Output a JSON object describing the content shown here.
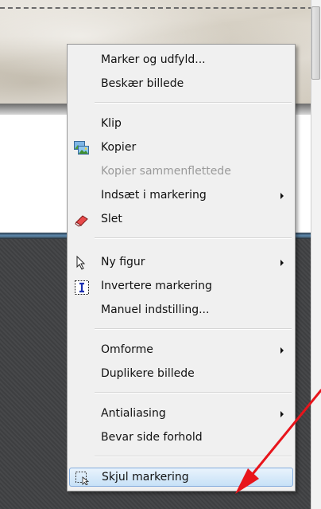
{
  "menu": {
    "items": [
      {
        "label": "Marker og udfyld...",
        "icon": null,
        "submenu": false,
        "disabled": false
      },
      {
        "label": "Beskær billede",
        "icon": null,
        "submenu": false,
        "disabled": false
      },
      {
        "label": "Klip",
        "icon": null,
        "submenu": false,
        "disabled": false
      },
      {
        "label": "Kopier",
        "icon": "copy-image-icon",
        "submenu": false,
        "disabled": false
      },
      {
        "label": "Kopier sammenflettede",
        "icon": null,
        "submenu": false,
        "disabled": true
      },
      {
        "label": "Indsæt i markering",
        "icon": null,
        "submenu": true,
        "disabled": false
      },
      {
        "label": "Slet",
        "icon": "eraser-icon",
        "submenu": false,
        "disabled": false
      },
      {
        "label": "Ny figur",
        "icon": "arrow-cursor-icon",
        "submenu": true,
        "disabled": false
      },
      {
        "label": "Invertere markering",
        "icon": "invert-selection-icon",
        "submenu": false,
        "disabled": false
      },
      {
        "label": "Manuel indstilling...",
        "icon": null,
        "submenu": false,
        "disabled": false
      },
      {
        "label": "Omforme",
        "icon": null,
        "submenu": true,
        "disabled": false
      },
      {
        "label": "Duplikere billede",
        "icon": null,
        "submenu": false,
        "disabled": false
      },
      {
        "label": "Antialiasing",
        "icon": null,
        "submenu": true,
        "disabled": false
      },
      {
        "label": "Bevar side forhold",
        "icon": null,
        "submenu": false,
        "disabled": false
      },
      {
        "label": "Skjul markering",
        "icon": "hide-selection-icon",
        "submenu": false,
        "disabled": false,
        "highlighted": true
      }
    ]
  },
  "colors": {
    "menu_bg": "#f0f0f0",
    "highlight_border": "#84acdd",
    "annotation_arrow": "#e8141b",
    "disabled_text": "#9a9a9a"
  }
}
